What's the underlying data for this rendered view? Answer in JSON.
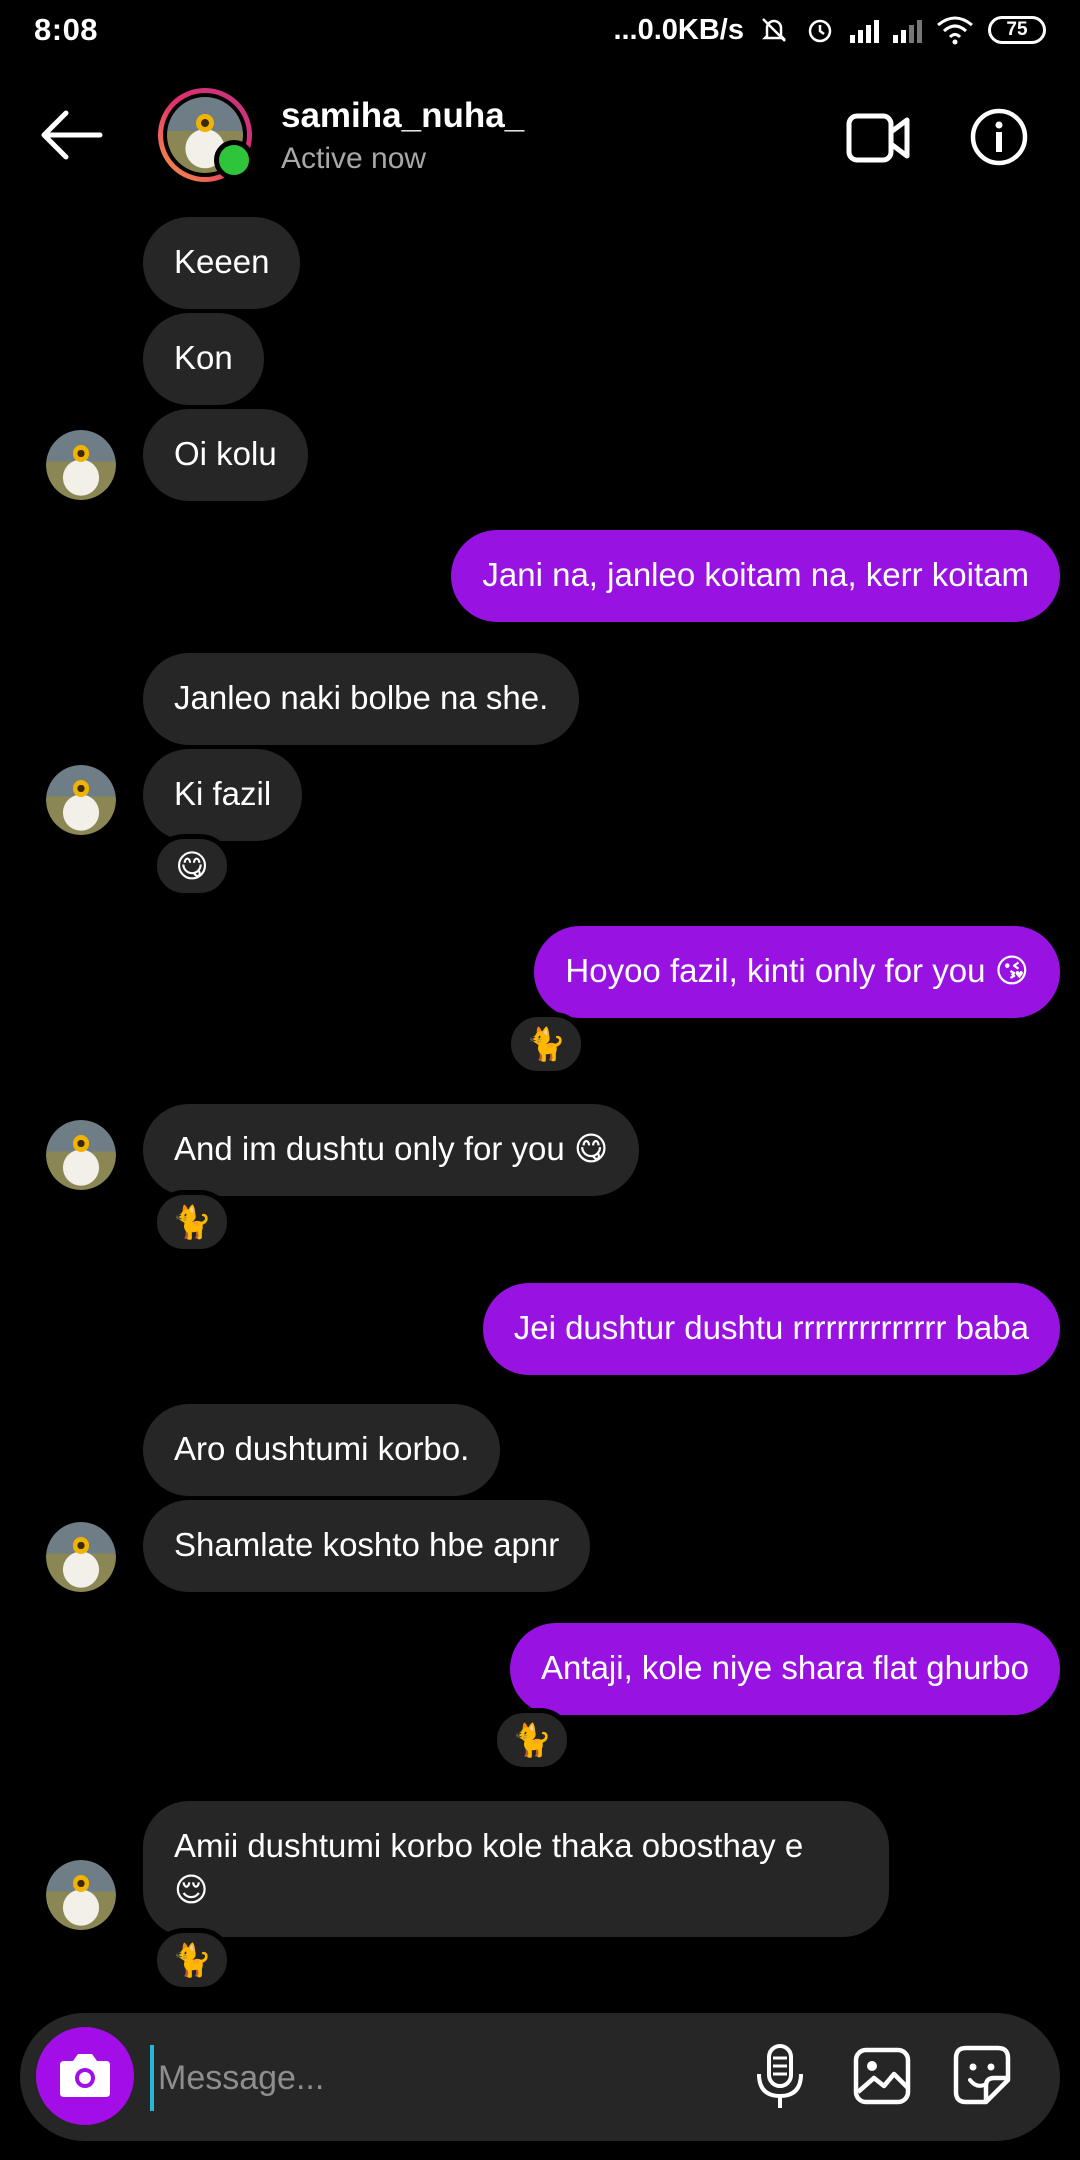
{
  "status_bar": {
    "time": "8:08",
    "network_speed": "...0.0KB/s",
    "battery": "75",
    "icons": [
      "mute-bell-icon",
      "alarm-icon",
      "signal-icon",
      "signal-weak-icon",
      "wifi-icon",
      "battery-icon"
    ]
  },
  "header": {
    "name": "samiha_nuha_",
    "status": "Active now",
    "icons": [
      "back-arrow-icon",
      "video-call-icon",
      "info-icon"
    ]
  },
  "messages": [
    {
      "dir": "in",
      "text": "Keeen"
    },
    {
      "dir": "in",
      "text": "Kon"
    },
    {
      "dir": "in",
      "text": "Oi kolu"
    },
    {
      "dir": "out",
      "text": "Jani na, janleo koitam na, kerr koitam"
    },
    {
      "dir": "in",
      "text": "Janleo naki bolbe na she."
    },
    {
      "dir": "in",
      "text": "Ki fazil",
      "reaction": "😋"
    },
    {
      "dir": "out",
      "text": "Hoyoo fazil, kinti only for you 😘",
      "reaction": "🐈"
    },
    {
      "dir": "in",
      "text": "And im dushtu only for you 😋",
      "reaction": "🐈"
    },
    {
      "dir": "out",
      "text": "Jei dushtur dushtu rrrrrrrrrrrrrr baba"
    },
    {
      "dir": "in",
      "text": "Aro dushtumi korbo."
    },
    {
      "dir": "in",
      "text": "Shamlate koshto hbe apnr"
    },
    {
      "dir": "out",
      "text": "Antaji, kole niye shara flat ghurbo",
      "reaction": "🐈"
    },
    {
      "dir": "in",
      "text": "Amii dushtumi korbo kole thaka obosthay e",
      "text2": "😌",
      "reaction": "🐈"
    }
  ],
  "composer": {
    "placeholder": "Message...",
    "icons": [
      "camera-icon",
      "microphone-icon",
      "gallery-icon",
      "sticker-icon"
    ]
  },
  "colors": {
    "background": "#000000",
    "incoming_bubble": "#262626",
    "outgoing_bubble": "#9812e1",
    "camera_button": "#a30ee8",
    "online_dot": "#2fc53b",
    "cursor": "#27b8d6"
  }
}
